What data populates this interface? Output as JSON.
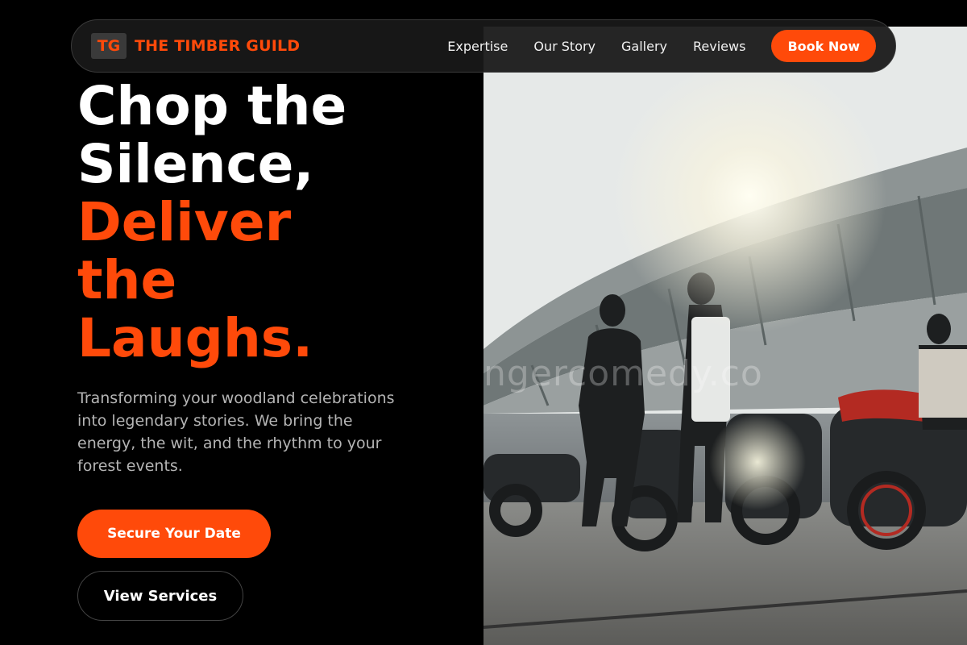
{
  "brand": {
    "badge": "TG",
    "name": "THE TIMBER GUILD"
  },
  "nav": {
    "links": [
      "Expertise",
      "Our Story",
      "Gallery",
      "Reviews"
    ],
    "cta": "Book Now"
  },
  "hero": {
    "headline_white_1": "Chop the",
    "headline_white_2": "Silence,",
    "headline_accent_1": "Deliver",
    "headline_accent_2": "the",
    "headline_accent_3": "Laughs.",
    "description": "Transforming your woodland celebrations into legendary stories. We bring the energy, the wit, and the rhythm to your forest events.",
    "primary_button": "Secure Your Date",
    "secondary_button": "View Services",
    "image_watermark": "ngercomedy.co"
  },
  "colors": {
    "accent": "#ff4a0a",
    "background": "#000000",
    "text_muted": "#b4b4b4"
  }
}
